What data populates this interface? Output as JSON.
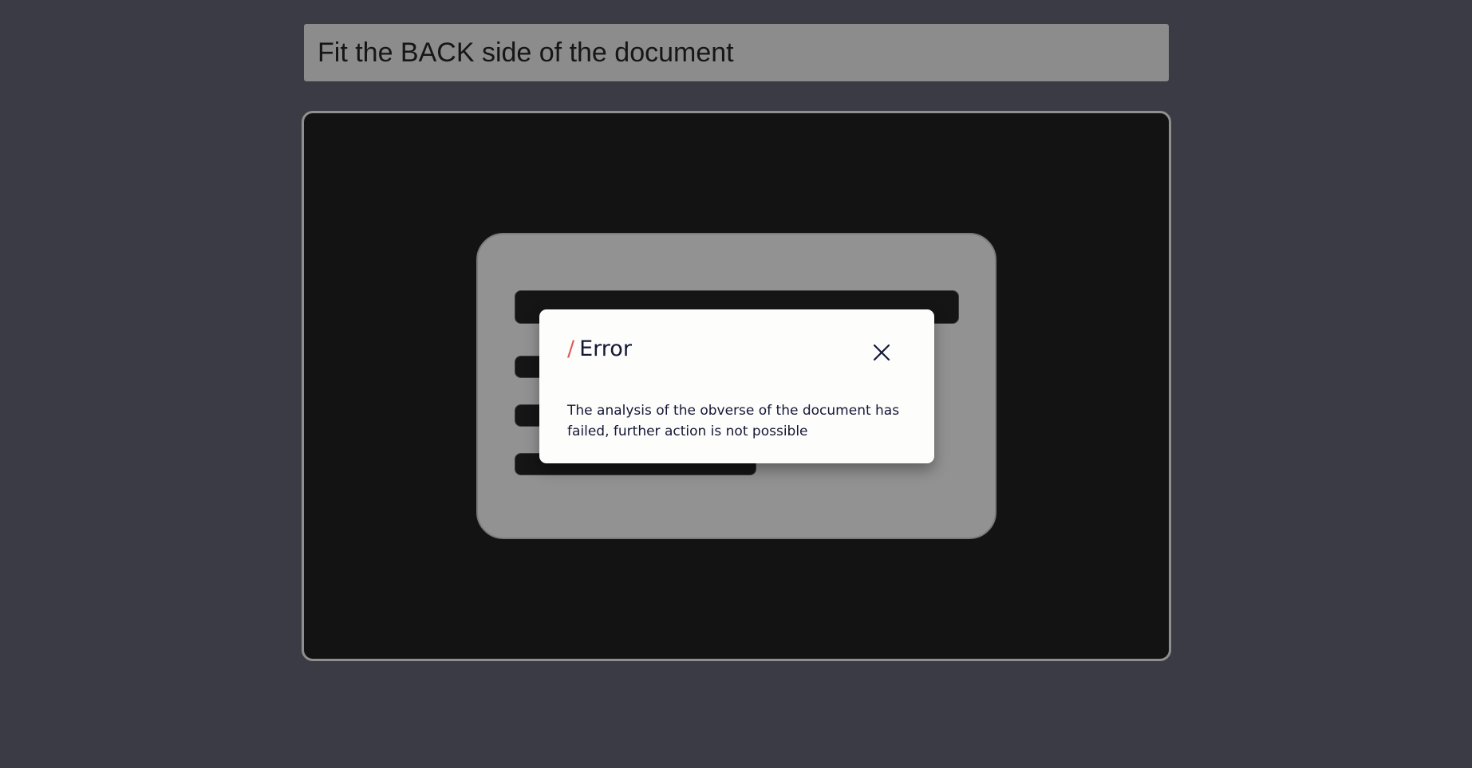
{
  "instruction": {
    "text": "Fit the BACK side of the document"
  },
  "dialog": {
    "title_prefix": "/",
    "title": "Error",
    "message": "The analysis of the obverse of the document has failed, further action is not possible",
    "close_icon": "close-icon"
  },
  "colors": {
    "background": "#3b3b46",
    "instruction_bar": "#8c8c8c",
    "camera_frame": "#131313",
    "document_card": "#929292",
    "accent_slash": "#e05a5a",
    "dialog_text": "#141836"
  }
}
